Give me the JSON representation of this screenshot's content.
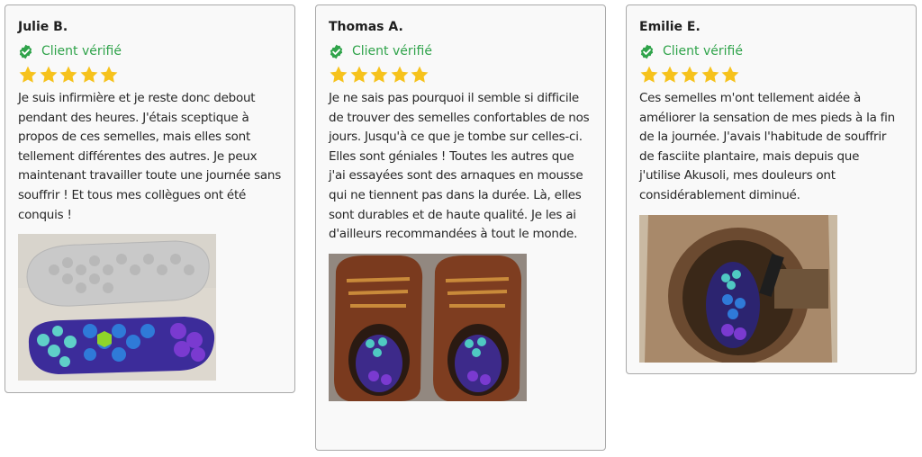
{
  "reviews": [
    {
      "name": "Julie B.",
      "verified_label": "Client vérifié",
      "rating": 5,
      "text": "Je suis infirmière et je reste donc debout pendant des heures. J'étais sceptique à propos de ces semelles, mais elles sont tellement différentes des autres. Je peux maintenant travailler toute une journée sans souffrir ! Et tous mes collègues ont été conquis !",
      "photo": "insole-photo"
    },
    {
      "name": "Thomas A.",
      "verified_label": "Client vérifié",
      "rating": 5,
      "text": "Je ne sais pas pourquoi il semble si difficile de trouver des semelles confortables de nos jours. Jusqu'à ce que je tombe sur celles-ci. Elles sont géniales ! Toutes les autres que j'ai essayées sont des arnaques en mousse qui ne tiennent pas dans la durée. Là, elles sont durables et de haute qualité. Je les ai d'ailleurs recommandées à tout le monde.",
      "photo": "boots-photo"
    },
    {
      "name": "Emilie E.",
      "verified_label": "Client vérifié",
      "rating": 5,
      "text": "Ces semelles m'ont tellement aidée à améliorer la sensation de mes pieds à la fin de la journée. J'avais l'habitude de souffrir de fasciite plantaire, mais depuis que j'utilise Akusoli, mes douleurs ont considérablement diminué.",
      "photo": "boot-interior-photo"
    }
  ],
  "colors": {
    "verified": "#2fa34a",
    "star": "#f6c21c",
    "card_border": "#a9a9a9",
    "card_bg": "#f9f9f9"
  }
}
